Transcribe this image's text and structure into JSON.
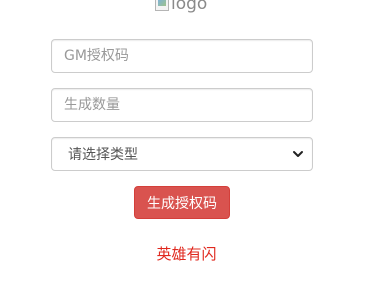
{
  "logo": {
    "alt_text": "logo"
  },
  "form": {
    "auth_code_placeholder": "GM授权码",
    "count_placeholder": "生成数量",
    "type_select": {
      "selected": "请选择类型"
    },
    "submit_label": "生成授权码"
  },
  "footer": {
    "link_text": "英雄有闪"
  },
  "colors": {
    "button_bg": "#d9534f",
    "link": "#e0281e"
  }
}
